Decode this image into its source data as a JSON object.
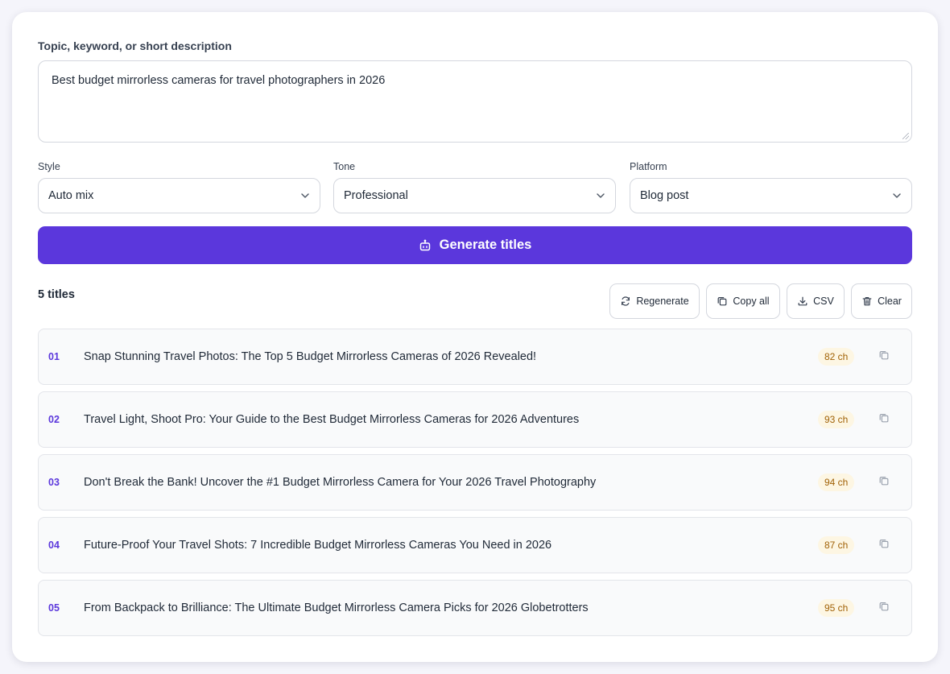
{
  "topic": {
    "label": "Topic, keyword, or short description",
    "value": "Best budget mirrorless cameras for travel photographers in 2026"
  },
  "selects": [
    {
      "label": "Style",
      "value": "Auto mix"
    },
    {
      "label": "Tone",
      "value": "Professional"
    },
    {
      "label": "Platform",
      "value": "Blog post"
    }
  ],
  "generate_label": "Generate titles",
  "results": {
    "count_label": "5 titles",
    "actions": {
      "regenerate": "Regenerate",
      "copy_all": "Copy all",
      "csv": "CSV",
      "clear": "Clear"
    },
    "items": [
      {
        "num": "01",
        "title": "Snap Stunning Travel Photos: The Top 5 Budget Mirrorless Cameras of 2026 Revealed!",
        "chars": "82 ch"
      },
      {
        "num": "02",
        "title": "Travel Light, Shoot Pro: Your Guide to the Best Budget Mirrorless Cameras for 2026 Adventures",
        "chars": "93 ch"
      },
      {
        "num": "03",
        "title": "Don't Break the Bank! Uncover the #1 Budget Mirrorless Camera for Your 2026 Travel Photography",
        "chars": "94 ch"
      },
      {
        "num": "04",
        "title": "Future-Proof Your Travel Shots: 7 Incredible Budget Mirrorless Cameras You Need in 2026",
        "chars": "87 ch"
      },
      {
        "num": "05",
        "title": "From Backpack to Brilliance: The Ultimate Budget Mirrorless Camera Picks for 2026 Globetrotters",
        "chars": "95 ch"
      }
    ]
  },
  "colors": {
    "accent": "#5b37dc",
    "badge_bg": "#fdf6e3",
    "badge_text": "#a16207"
  }
}
